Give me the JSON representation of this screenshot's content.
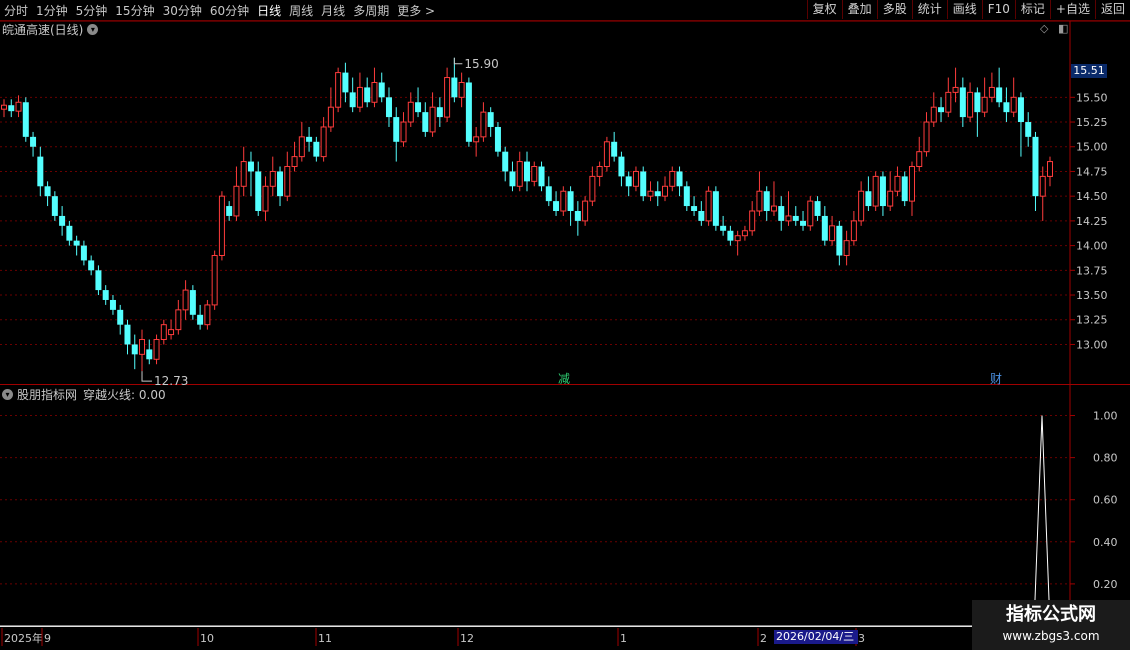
{
  "toolbar": {
    "periods": [
      "分时",
      "1分钟",
      "5分钟",
      "15分钟",
      "30分钟",
      "60分钟",
      "日线",
      "周线",
      "月线",
      "多周期",
      "更多 >"
    ],
    "active_period": "日线",
    "actions": [
      "复权",
      "叠加",
      "多股",
      "统计",
      "画线",
      "F10",
      "标记",
      "+自选",
      "返回"
    ]
  },
  "main": {
    "stock_title": "皖通高速(日线)",
    "high_label": "15.90",
    "low_label": "12.73",
    "current_price": "15.51",
    "y_ticks": [
      "15.50",
      "15.25",
      "15.00",
      "14.75",
      "14.50",
      "14.25",
      "14.00",
      "13.75",
      "13.50",
      "13.25",
      "13.00"
    ],
    "markers": [
      {
        "text": "减",
        "color": "#2ecc71"
      },
      {
        "text": "财",
        "color": "#4a90e2"
      }
    ]
  },
  "indicator": {
    "title": "股朋指标网",
    "line_label": "穿越火线: 0.00",
    "y_ticks": [
      "1.00",
      "0.80",
      "0.60",
      "0.40",
      "0.20"
    ]
  },
  "time_axis": {
    "labels": [
      "2025年",
      "9",
      "10",
      "11",
      "12",
      "1",
      "2",
      "3"
    ],
    "cursor_date": "2026/02/04/三"
  },
  "watermark": {
    "line1": "指标公式网",
    "line2": "www.zbgs3.com"
  },
  "colors": {
    "up": "#ff3c3c",
    "down": "#54ffff",
    "grid": "#6a0000",
    "axis": "#a00000",
    "accent": "#ffffff"
  },
  "chart_data": {
    "type": "candlestick",
    "y_range": [
      12.6,
      16.1
    ],
    "indicator_range": [
      0,
      1.05
    ],
    "candles": [
      [
        15.38,
        15.42,
        15.3,
        15.48
      ],
      [
        15.42,
        15.36,
        15.3,
        15.48
      ],
      [
        15.36,
        15.45,
        15.3,
        15.52
      ],
      [
        15.45,
        15.1,
        15.05,
        15.5
      ],
      [
        15.1,
        15.0,
        14.9,
        15.15
      ],
      [
        14.9,
        14.6,
        14.5,
        15.0
      ],
      [
        14.6,
        14.5,
        14.4,
        14.65
      ],
      [
        14.5,
        14.3,
        14.25,
        14.55
      ],
      [
        14.3,
        14.2,
        14.1,
        14.4
      ],
      [
        14.2,
        14.05,
        14.0,
        14.25
      ],
      [
        14.05,
        14.0,
        13.9,
        14.1
      ],
      [
        14.0,
        13.85,
        13.8,
        14.05
      ],
      [
        13.85,
        13.75,
        13.7,
        13.9
      ],
      [
        13.75,
        13.55,
        13.5,
        13.8
      ],
      [
        13.55,
        13.45,
        13.4,
        13.6
      ],
      [
        13.45,
        13.35,
        13.3,
        13.5
      ],
      [
        13.35,
        13.2,
        13.1,
        13.4
      ],
      [
        13.2,
        13.0,
        12.9,
        13.25
      ],
      [
        13.0,
        12.9,
        12.75,
        13.1
      ],
      [
        12.9,
        13.05,
        12.73,
        13.15
      ],
      [
        12.95,
        12.85,
        12.8,
        13.05
      ],
      [
        12.85,
        13.05,
        12.8,
        13.1
      ],
      [
        13.05,
        13.2,
        13.0,
        13.25
      ],
      [
        13.1,
        13.15,
        13.05,
        13.25
      ],
      [
        13.15,
        13.35,
        13.1,
        13.45
      ],
      [
        13.35,
        13.55,
        13.25,
        13.65
      ],
      [
        13.55,
        13.3,
        13.25,
        13.6
      ],
      [
        13.3,
        13.2,
        13.15,
        13.4
      ],
      [
        13.2,
        13.4,
        13.15,
        13.45
      ],
      [
        13.4,
        13.9,
        13.35,
        13.95
      ],
      [
        13.9,
        14.5,
        13.85,
        14.55
      ],
      [
        14.4,
        14.3,
        14.25,
        14.45
      ],
      [
        14.3,
        14.6,
        14.25,
        14.8
      ],
      [
        14.6,
        14.85,
        14.5,
        15.0
      ],
      [
        14.85,
        14.75,
        14.5,
        14.95
      ],
      [
        14.75,
        14.35,
        14.3,
        14.85
      ],
      [
        14.35,
        14.6,
        14.25,
        14.7
      ],
      [
        14.6,
        14.75,
        14.5,
        14.9
      ],
      [
        14.75,
        14.5,
        14.4,
        14.8
      ],
      [
        14.5,
        14.8,
        14.45,
        14.95
      ],
      [
        14.8,
        14.9,
        14.75,
        15.05
      ],
      [
        14.9,
        15.1,
        14.85,
        15.25
      ],
      [
        15.1,
        15.05,
        14.95,
        15.2
      ],
      [
        15.05,
        14.9,
        14.85,
        15.1
      ],
      [
        14.9,
        15.2,
        14.85,
        15.3
      ],
      [
        15.2,
        15.4,
        15.15,
        15.6
      ],
      [
        15.4,
        15.75,
        15.35,
        15.8
      ],
      [
        15.75,
        15.55,
        15.45,
        15.85
      ],
      [
        15.55,
        15.4,
        15.35,
        15.7
      ],
      [
        15.4,
        15.6,
        15.35,
        15.75
      ],
      [
        15.6,
        15.45,
        15.4,
        15.7
      ],
      [
        15.45,
        15.65,
        15.4,
        15.8
      ],
      [
        15.65,
        15.5,
        15.45,
        15.75
      ],
      [
        15.5,
        15.3,
        15.2,
        15.6
      ],
      [
        15.3,
        15.05,
        14.85,
        15.4
      ],
      [
        15.05,
        15.25,
        15.0,
        15.35
      ],
      [
        15.25,
        15.45,
        15.2,
        15.55
      ],
      [
        15.45,
        15.35,
        15.3,
        15.6
      ],
      [
        15.35,
        15.15,
        15.1,
        15.45
      ],
      [
        15.15,
        15.4,
        15.1,
        15.55
      ],
      [
        15.4,
        15.3,
        15.2,
        15.5
      ],
      [
        15.3,
        15.7,
        15.25,
        15.8
      ],
      [
        15.7,
        15.5,
        15.45,
        15.9
      ],
      [
        15.5,
        15.65,
        15.4,
        15.75
      ],
      [
        15.65,
        15.05,
        15.0,
        15.7
      ],
      [
        15.05,
        15.1,
        14.9,
        15.2
      ],
      [
        15.1,
        15.35,
        15.05,
        15.45
      ],
      [
        15.35,
        15.2,
        15.1,
        15.4
      ],
      [
        15.2,
        14.95,
        14.9,
        15.25
      ],
      [
        14.95,
        14.75,
        14.65,
        15.0
      ],
      [
        14.75,
        14.6,
        14.55,
        14.85
      ],
      [
        14.6,
        14.85,
        14.55,
        14.95
      ],
      [
        14.85,
        14.65,
        14.55,
        14.95
      ],
      [
        14.65,
        14.8,
        14.6,
        14.85
      ],
      [
        14.8,
        14.6,
        14.55,
        14.85
      ],
      [
        14.6,
        14.45,
        14.4,
        14.7
      ],
      [
        14.45,
        14.35,
        14.3,
        14.55
      ],
      [
        14.35,
        14.55,
        14.3,
        14.6
      ],
      [
        14.55,
        14.35,
        14.2,
        14.6
      ],
      [
        14.35,
        14.25,
        14.1,
        14.45
      ],
      [
        14.25,
        14.45,
        14.2,
        14.5
      ],
      [
        14.45,
        14.7,
        14.4,
        14.8
      ],
      [
        14.7,
        14.8,
        14.6,
        14.85
      ],
      [
        14.8,
        15.05,
        14.75,
        15.1
      ],
      [
        15.05,
        14.9,
        14.85,
        15.15
      ],
      [
        14.9,
        14.7,
        14.6,
        14.95
      ],
      [
        14.7,
        14.6,
        14.5,
        14.75
      ],
      [
        14.6,
        14.75,
        14.55,
        14.8
      ],
      [
        14.75,
        14.5,
        14.45,
        14.8
      ],
      [
        14.5,
        14.55,
        14.45,
        14.65
      ],
      [
        14.55,
        14.5,
        14.4,
        14.65
      ],
      [
        14.5,
        14.6,
        14.45,
        14.7
      ],
      [
        14.6,
        14.75,
        14.55,
        14.8
      ],
      [
        14.75,
        14.6,
        14.5,
        14.8
      ],
      [
        14.6,
        14.4,
        14.35,
        14.65
      ],
      [
        14.4,
        14.35,
        14.3,
        14.5
      ],
      [
        14.35,
        14.25,
        14.2,
        14.45
      ],
      [
        14.25,
        14.55,
        14.2,
        14.6
      ],
      [
        14.55,
        14.2,
        14.15,
        14.6
      ],
      [
        14.2,
        14.15,
        14.1,
        14.3
      ],
      [
        14.15,
        14.05,
        14.0,
        14.2
      ],
      [
        14.05,
        14.1,
        13.9,
        14.15
      ],
      [
        14.1,
        14.15,
        14.05,
        14.2
      ],
      [
        14.15,
        14.35,
        14.1,
        14.45
      ],
      [
        14.35,
        14.55,
        14.3,
        14.75
      ],
      [
        14.55,
        14.35,
        14.25,
        14.6
      ],
      [
        14.35,
        14.4,
        14.3,
        14.65
      ],
      [
        14.4,
        14.25,
        14.15,
        14.5
      ],
      [
        14.25,
        14.3,
        14.2,
        14.55
      ],
      [
        14.3,
        14.25,
        14.2,
        14.4
      ],
      [
        14.25,
        14.2,
        14.15,
        14.35
      ],
      [
        14.2,
        14.45,
        14.15,
        14.5
      ],
      [
        14.45,
        14.3,
        14.25,
        14.5
      ],
      [
        14.3,
        14.05,
        14.0,
        14.4
      ],
      [
        14.05,
        14.2,
        14.0,
        14.3
      ],
      [
        14.2,
        13.9,
        13.8,
        14.25
      ],
      [
        13.9,
        14.05,
        13.8,
        14.15
      ],
      [
        14.05,
        14.25,
        14.0,
        14.35
      ],
      [
        14.25,
        14.55,
        14.2,
        14.65
      ],
      [
        14.55,
        14.4,
        14.35,
        14.7
      ],
      [
        14.4,
        14.7,
        14.35,
        14.75
      ],
      [
        14.7,
        14.4,
        14.3,
        14.75
      ],
      [
        14.4,
        14.55,
        14.35,
        14.75
      ],
      [
        14.55,
        14.7,
        14.5,
        14.8
      ],
      [
        14.7,
        14.45,
        14.4,
        14.75
      ],
      [
        14.45,
        14.8,
        14.3,
        14.85
      ],
      [
        14.8,
        14.95,
        14.75,
        15.1
      ],
      [
        14.95,
        15.25,
        14.9,
        15.35
      ],
      [
        15.25,
        15.4,
        15.2,
        15.55
      ],
      [
        15.4,
        15.35,
        15.25,
        15.5
      ],
      [
        15.35,
        15.55,
        15.3,
        15.7
      ],
      [
        15.55,
        15.6,
        15.45,
        15.8
      ],
      [
        15.6,
        15.3,
        15.2,
        15.7
      ],
      [
        15.3,
        15.55,
        15.25,
        15.65
      ],
      [
        15.55,
        15.35,
        15.1,
        15.6
      ],
      [
        15.35,
        15.5,
        15.3,
        15.7
      ],
      [
        15.5,
        15.6,
        15.45,
        15.75
      ],
      [
        15.6,
        15.45,
        15.4,
        15.8
      ],
      [
        15.45,
        15.35,
        15.25,
        15.6
      ],
      [
        15.35,
        15.5,
        15.3,
        15.7
      ],
      [
        15.5,
        15.25,
        14.9,
        15.55
      ],
      [
        15.25,
        15.1,
        15.0,
        15.35
      ],
      [
        15.1,
        14.5,
        14.35,
        15.15
      ],
      [
        14.5,
        14.7,
        14.25,
        14.8
      ],
      [
        14.7,
        14.85,
        14.6,
        14.9
      ]
    ],
    "indicator_values": "all 0.00 except a spike to 1.00 at the last candles"
  }
}
